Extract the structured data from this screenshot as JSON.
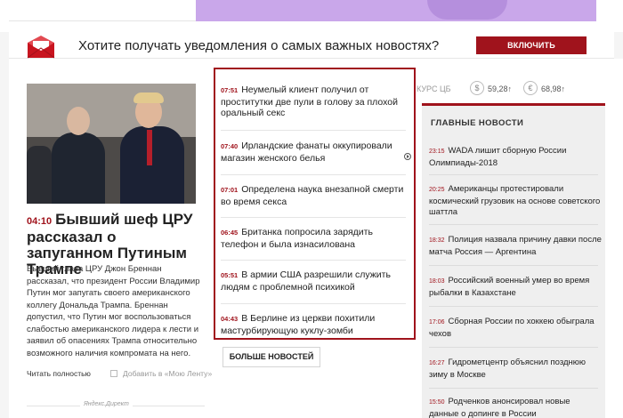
{
  "notification": {
    "message": "Хотите получать уведомления о самых важных новостях?",
    "button_label": "ВКЛЮЧИТЬ УВЕДОМЛЕНИЯ"
  },
  "article": {
    "time": "04:10",
    "title": "Бывший шеф ЦРУ рассказал о запуганном Путиным Трампе",
    "text": "Бывший глава ЦРУ Джон Бреннан рассказал, что президент России Владимир Путин мог запугать своего американского коллегу Дональда Трампа. Бреннан допустил, что Путин мог воспользоваться слабостью американского лидера к лести и заявил об опасениях Трампа относительно возможного наличия компромата на него.",
    "read_more": "Читать полностью",
    "add_to_feed": "Добавить в «Мою Ленту»",
    "yandex_direct": "Яндекс.Директ"
  },
  "news_list": [
    {
      "time": "07:51",
      "text": "Неумелый клиент получил от проститутки две пули в голову за плохой оральный секс"
    },
    {
      "time": "07:40",
      "text": "Ирландские фанаты оккупировали магазин женского белья"
    },
    {
      "time": "07:01",
      "text": "Определена наука внезапной смерти во время секса"
    },
    {
      "time": "06:45",
      "text": "Британка попросила зарядить телефон и была изнасилована"
    },
    {
      "time": "05:51",
      "text": "В армии США разрешили служить людям с проблемной психикой"
    },
    {
      "time": "04:43",
      "text": "В Берлине из церкви похитили мастурбирующую куклу-зомби"
    }
  ],
  "more_news_label": "БОЛЬШЕ НОВОСТЕЙ",
  "rates": {
    "label": "КУРС ЦБ",
    "usd_symbol": "$",
    "usd_value": "59,28↑",
    "eur_symbol": "€",
    "eur_value": "68,98↑"
  },
  "main_news": {
    "header": "ГЛАВНЫЕ НОВОСТИ",
    "items": [
      {
        "time": "23:15",
        "text": "WADA лишит сборную России Олимпиады-2018"
      },
      {
        "time": "20:25",
        "text": "Американцы протестировали космический грузовик на основе советского шаттла"
      },
      {
        "time": "18:32",
        "text": "Полиция назвала причину давки после матча Россия — Аргентина"
      },
      {
        "time": "18:03",
        "text": "Российский военный умер во время рыбалки в Казахстане"
      },
      {
        "time": "17:06",
        "text": "Сборная России по хоккею обыграла чехов"
      },
      {
        "time": "16:27",
        "text": "Гидрометцентр объяснил позднюю зиму в Москве"
      },
      {
        "time": "15:50",
        "text": "Родченков анонсировал новые данные о допинге в России"
      }
    ]
  },
  "colors": {
    "accent": "#a0131c",
    "banner": "#c9a7ea"
  }
}
